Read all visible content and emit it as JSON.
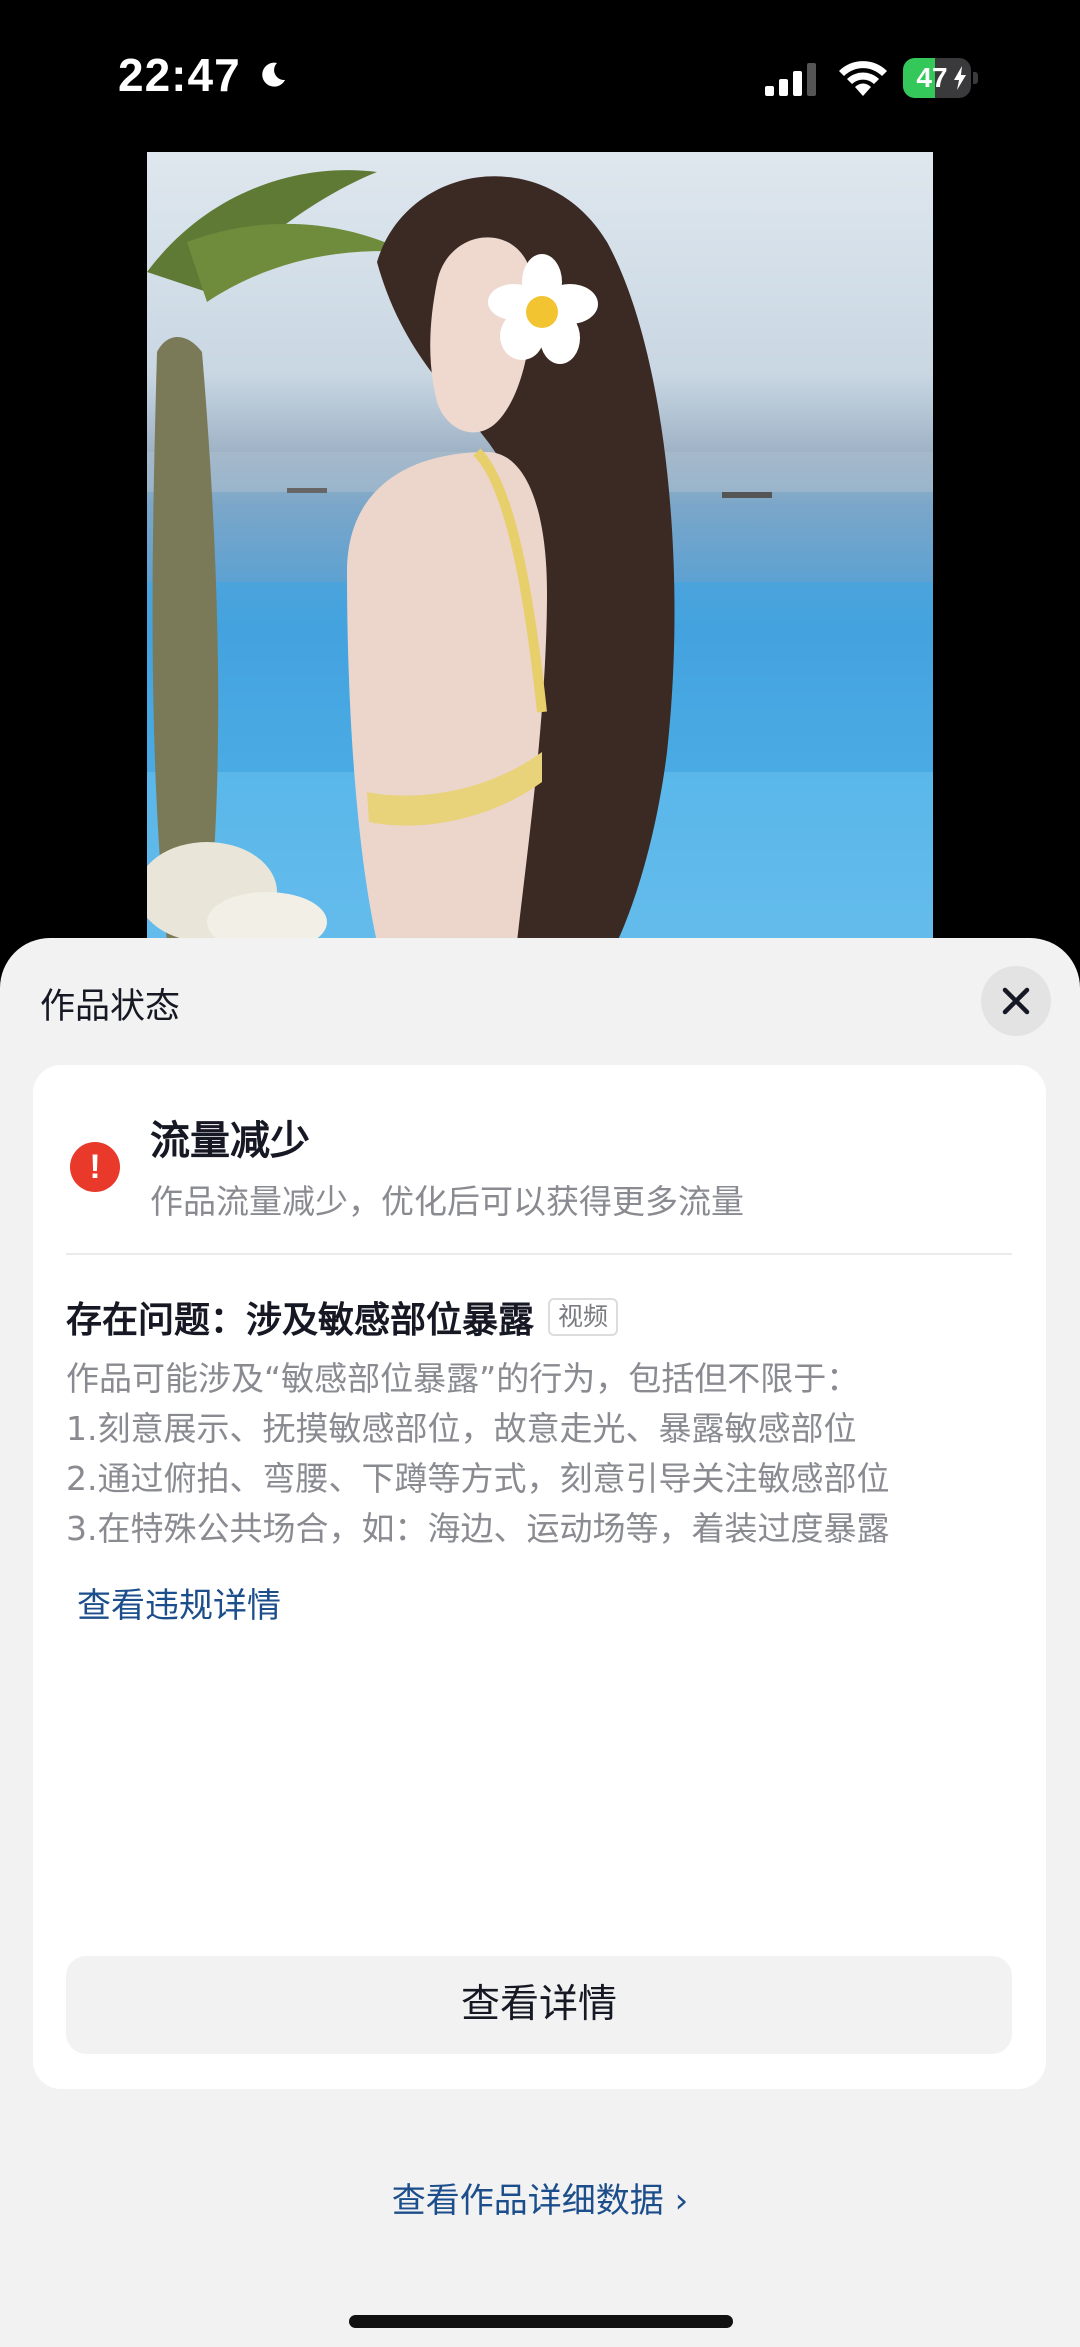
{
  "status_bar": {
    "time": "22:47",
    "battery_text": "47",
    "battery_level": 0.47,
    "battery_color": "#34c759"
  },
  "icons": {
    "moon": "moon-icon",
    "signal": "cellular-signal-icon",
    "wifi": "wifi-icon",
    "battery": "battery-charging-icon",
    "close": "close-icon",
    "alert": "exclamation-icon",
    "chevron": "chevron-right-icon"
  },
  "sheet": {
    "title": "作品状态",
    "status": {
      "heading": "流量减少",
      "description": "作品流量减少，优化后可以获得更多流量",
      "icon_color": "#e8392a"
    },
    "issue": {
      "title": "存在问题：涉及敏感部位暴露",
      "tag": "视频",
      "lines": [
        "作品可能涉及“敏感部位暴露”的行为，包括但不限于：",
        "1.刻意展示、抚摸敏感部位，故意走光、暴露敏感部位",
        "2.通过俯拍、弯腰、下蹲等方式，刻意引导关注敏感部位",
        "3.在特殊公共场合，如：海边、运动场等，着装过度暴露"
      ],
      "link": "查看违规详情"
    },
    "details_button": "查看详情",
    "data_link": "查看作品详细数据 ›"
  },
  "colors": {
    "link": "#1c4e8c",
    "sheet_bg": "#f2f2f2",
    "text_primary": "#161823",
    "text_secondary": "#8a8b91"
  }
}
